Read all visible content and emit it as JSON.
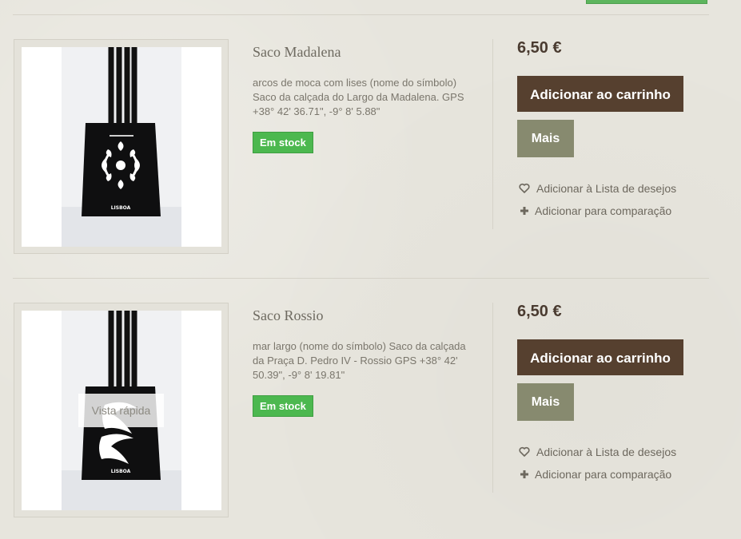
{
  "products": [
    {
      "name": "Saco Madalena",
      "description": "arcos de moca com lises  (nome do símbolo) Saco da calçada do Largo da Madalena. GPS +38° 42' 36.71\", -9° 8' 5.88\"",
      "stock": "Em stock",
      "price": "6,50 €",
      "add_to_cart": "Adicionar ao carrinho",
      "more": "Mais",
      "wishlist": "Adicionar à Lista de desejos",
      "compare": "Adicionar para comparação",
      "image_brand": "LISBOA"
    },
    {
      "name": "Saco Rossio",
      "description": "mar largo (nome do símbolo) Saco da calçada da Praça D. Pedro IV -  Rossio GPS +38° 42' 50.39\", -9° 8' 19.81\"",
      "stock": "Em stock",
      "price": "6,50 €",
      "add_to_cart": "Adicionar ao carrinho",
      "more": "Mais",
      "wishlist": "Adicionar à Lista de desejos",
      "compare": "Adicionar para comparação",
      "quick_view": "Vista rápida",
      "image_brand": "LISBOA"
    }
  ],
  "colors": {
    "cart_button": "#56402f",
    "more_button": "#878a6f",
    "stock_badge": "#4cb84f",
    "price": "#4a3b30"
  },
  "icons": {
    "wishlist": "heart-outline-icon",
    "compare": "plus-icon"
  }
}
